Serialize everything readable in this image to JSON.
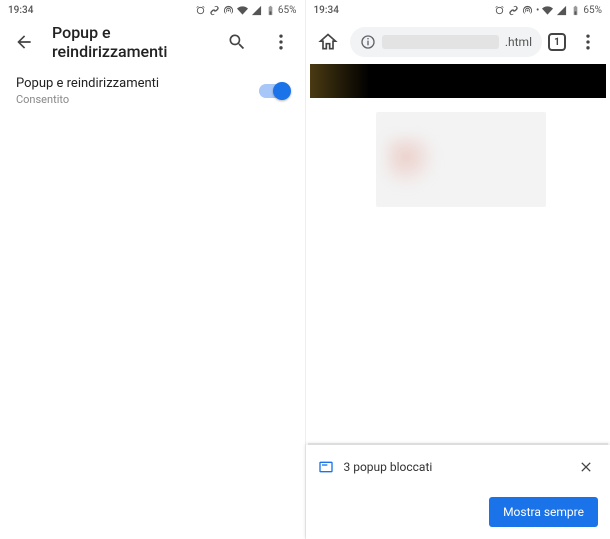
{
  "status": {
    "time": "19:34",
    "battery": "65%"
  },
  "left": {
    "header_title": "Popup e reindirizzamenti",
    "setting_title": "Popup e reindirizzamenti",
    "setting_status": "Consentito"
  },
  "right": {
    "url_suffix": ".html",
    "tab_count": "1",
    "popup_message": "3 popup bloccati",
    "action_label": "Mostra sempre"
  }
}
